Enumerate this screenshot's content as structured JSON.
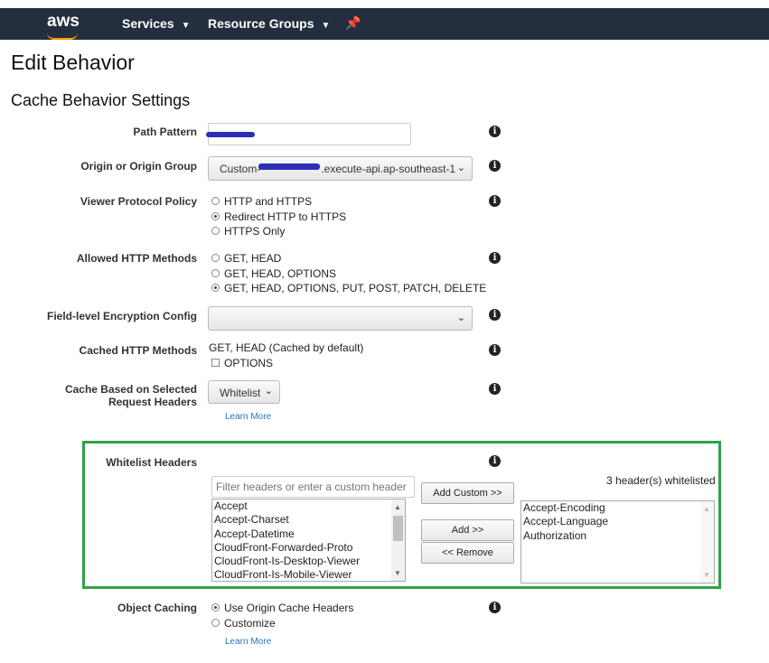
{
  "topbar": {
    "logo": "aws",
    "services": "Services",
    "resource_groups": "Resource Groups",
    "pin_icon": "pin-icon"
  },
  "page_title": "Edit Behavior",
  "section_title": "Cache Behavior Settings",
  "form": {
    "path_pattern": {
      "label": "Path Pattern",
      "value": ""
    },
    "origin": {
      "label": "Origin or Origin Group",
      "value": "Custom-",
      "value_suffix": ".execute-api.ap-southeast-1"
    },
    "viewer_protocol": {
      "label": "Viewer Protocol Policy",
      "options": [
        "HTTP and HTTPS",
        "Redirect HTTP to HTTPS",
        "HTTPS Only"
      ],
      "selected": 1
    },
    "allowed_methods": {
      "label": "Allowed HTTP Methods",
      "options": [
        "GET, HEAD",
        "GET, HEAD, OPTIONS",
        "GET, HEAD, OPTIONS, PUT, POST, PATCH, DELETE"
      ],
      "selected": 2
    },
    "fle_config": {
      "label": "Field-level Encryption Config",
      "value": ""
    },
    "cached_methods": {
      "label": "Cached HTTP Methods",
      "text": "GET, HEAD (Cached by default)",
      "options_label": "OPTIONS"
    },
    "cache_headers": {
      "label_line1": "Cache Based on Selected",
      "label_line2": "Request Headers",
      "value": "Whitelist",
      "learn_more": "Learn More"
    },
    "whitelist": {
      "label": "Whitelist Headers",
      "filter_placeholder": "Filter headers or enter a custom header",
      "count_text": "3 header(s) whitelisted",
      "add_custom": "Add Custom >>",
      "add": "Add >>",
      "remove": "<< Remove",
      "available": [
        "Accept",
        "Accept-Charset",
        "Accept-Datetime",
        "CloudFront-Forwarded-Proto",
        "CloudFront-Is-Desktop-Viewer",
        "CloudFront-Is-Mobile-Viewer"
      ],
      "selected": [
        "Accept-Encoding",
        "Accept-Language",
        "Authorization"
      ]
    },
    "object_caching": {
      "label": "Object Caching",
      "options": [
        "Use Origin Cache Headers",
        "Customize"
      ],
      "selected": 0,
      "learn_more": "Learn More"
    }
  },
  "colors": {
    "topbar": "#232f3e",
    "highlight_border": "#2ca24a",
    "link": "#2a74b9",
    "aws_orange": "#ff9900"
  }
}
